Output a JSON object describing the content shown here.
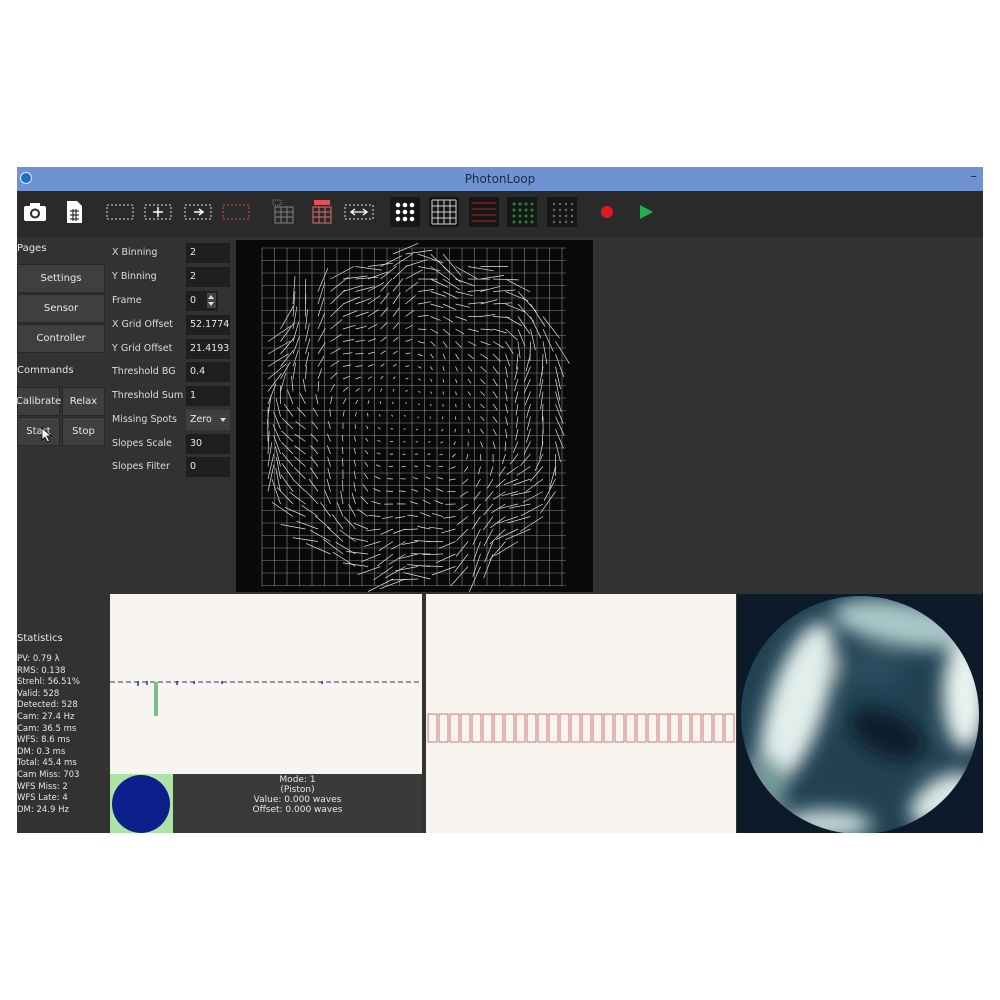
{
  "window": {
    "title": "PhotonLoop",
    "minimize_glyph": "–"
  },
  "toolbar": {
    "buttons": [
      {
        "icon": "camera-icon"
      },
      {
        "icon": "file-grid-icon"
      },
      {
        "icon": "select-region-icon"
      },
      {
        "icon": "move-region-icon"
      },
      {
        "icon": "resize-region-icon"
      },
      {
        "icon": "clear-region-icon"
      },
      {
        "icon": "grid-sub-icon"
      },
      {
        "icon": "grid-red-icon"
      },
      {
        "icon": "grid-shift-icon"
      },
      {
        "icon": "spots-icon"
      },
      {
        "icon": "grid-icon"
      },
      {
        "icon": "red-grid-icon"
      },
      {
        "icon": "green-dots-icon"
      },
      {
        "icon": "gray-dots-icon"
      },
      {
        "icon": "record-icon"
      },
      {
        "icon": "play-icon"
      }
    ],
    "colors": {
      "record": "#e0191f",
      "play": "#22b14c"
    }
  },
  "pages": {
    "title": "Pages",
    "settings": "Settings",
    "sensor": "Sensor",
    "controller": "Controller"
  },
  "commands": {
    "title": "Commands",
    "calibrate": "Calibrate",
    "relax": "Relax",
    "start": "Start",
    "stop": "Stop"
  },
  "params": [
    {
      "label": "X Binning",
      "value": "2"
    },
    {
      "label": "Y Binning",
      "value": "2"
    },
    {
      "label": "Frame",
      "value": "0"
    },
    {
      "label": "X Grid Offset",
      "value": "52.1774"
    },
    {
      "label": "Y Grid Offset",
      "value": "21.4193"
    },
    {
      "label": "Threshold BG",
      "value": "0.4"
    },
    {
      "label": "Threshold Sum",
      "value": "1"
    },
    {
      "label": "Missing Spots",
      "value": "Zero"
    },
    {
      "label": "Slopes Scale",
      "value": "30"
    },
    {
      "label": "Slopes Filter",
      "value": "0"
    }
  ],
  "statistics": {
    "title": "Statistics",
    "lines": [
      "PV: 0.79 λ",
      "RMS: 0.138",
      "Strehl: 56.51%",
      "Valid: 528",
      "Detected: 528",
      "Cam: 27.4 Hz",
      "Cam: 36.5 ms",
      "WFS: 8.6 ms",
      "DM: 0.3 ms",
      "Total: 45.4 ms",
      "Cam Miss: 703",
      "WFS Miss: 2",
      "WFS Late: 4",
      "DM: 24.9 Hz"
    ]
  },
  "mode_info": {
    "line1": "Mode: 1",
    "line2": "(Piston)",
    "line3": "Value: 0.000 waves",
    "line4": "Offset: 0.000 waves"
  },
  "colors": {
    "accent_green": "#aee2a6",
    "disk_blue": "#0c1f8a",
    "titlebar": "#6f93d2",
    "pulse_red": "#c85a5a"
  }
}
